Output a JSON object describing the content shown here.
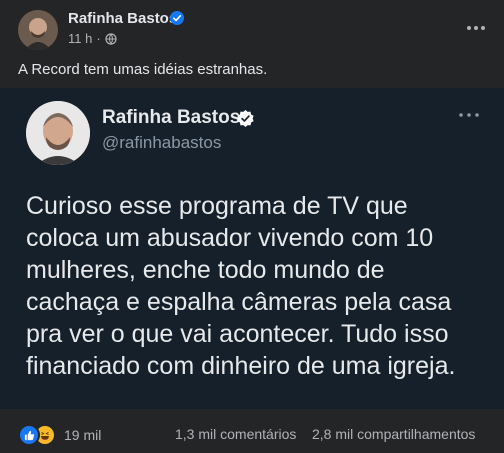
{
  "post": {
    "author": "Rafinha Bastos",
    "time": "11 h",
    "separator": "·",
    "caption": "A Record tem umas idéias estranhas."
  },
  "tweet": {
    "name": "Rafinha Bastos",
    "handle": "@rafinhabastos",
    "lines": [
      "Curioso esse programa de TV que",
      "coloca um abusador vivendo com 10",
      "mulheres, enche todo mundo de",
      "cachaça e espalha câmeras pela casa",
      "pra ver o que vai acontecer. Tudo isso",
      "financiado com dinheiro de uma igreja."
    ]
  },
  "footer": {
    "reaction_count": "19 mil",
    "comments": "1,3 mil comentários",
    "shares": "2,8 mil compartilhamentos"
  },
  "colors": {
    "fb_card": "#242526",
    "tweet_bg": "#15202b",
    "verified_blue": "#1877f2",
    "tweet_verified": "#ffffff"
  },
  "icons": [
    "verified-icon",
    "globe-icon",
    "more-icon",
    "like-reaction-icon",
    "haha-reaction-icon"
  ]
}
